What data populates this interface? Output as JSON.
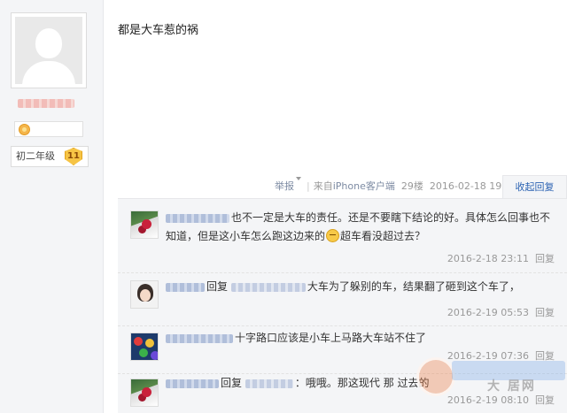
{
  "user": {
    "level_label": "初二年级",
    "level_number": "11"
  },
  "post": {
    "text": "都是大车惹的祸",
    "report_label": "举报",
    "separator": "|",
    "source_prefix": "来自",
    "source_link": "iPhone客户端",
    "floor": "29楼",
    "datetime": "2016-02-18 19:18",
    "collapse_label": "收起回复"
  },
  "replies": [
    {
      "text_before_emoji": "也不一定是大车的责任。还是不要瞎下结论的好。具体怎么回事也不知道，但是这小车怎么跑这边来的",
      "text_after_emoji": "超车看没超过去？",
      "time": "2016-2-18 23:11",
      "time_suffix": "回复"
    },
    {
      "reply_word": "回复",
      "text": "大车为了躲别的车，结果翻了砸到这个车了，",
      "time": "2016-2-19 05:53",
      "time_suffix": "回复"
    },
    {
      "text": "十字路口应该是小车上马路大车站不住了",
      "time": "2016-2-19 07:36",
      "time_suffix": "回复"
    },
    {
      "reply_word": "回复",
      "text": "：哦哦。那这现代",
      "text_tail": "那 过去的",
      "time": "2016-2-19 08:10",
      "time_suffix": "回复"
    }
  ],
  "watermark": {
    "text": "大 居网"
  },
  "colors": {
    "link": "#2d64b3",
    "meta": "#999999",
    "panel": "#f4f5f7"
  }
}
